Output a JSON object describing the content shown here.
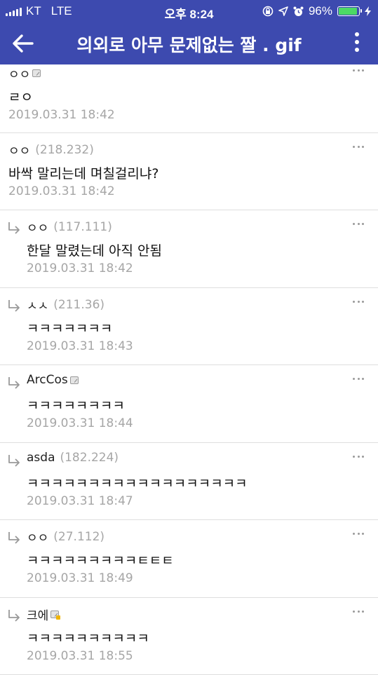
{
  "status_bar": {
    "carrier": "KT",
    "network": "LTE",
    "time": "오후 8:24",
    "battery_percent": "96%",
    "battery_level": 0.96,
    "icons": [
      "signal-icon",
      "orientation-lock-icon",
      "location-icon",
      "alarm-icon",
      "battery-icon",
      "charging-icon"
    ]
  },
  "toolbar": {
    "title": "의외로 아무 문제없는 짤 . gif",
    "back_icon": "back-arrow-icon",
    "menu_icon": "more-vertical-icon"
  },
  "colors": {
    "toolbar": "#3d4aaf",
    "meta": "#a6a6a6",
    "divider": "#dedede"
  },
  "comments": [
    {
      "author": "ㅇㅇ",
      "ip": "",
      "badge": "member",
      "reply": false,
      "body": "ㄹㅇ",
      "time": "2019.03.31 18:42"
    },
    {
      "author": "ㅇㅇ",
      "ip": "(218.232)",
      "badge": "",
      "reply": false,
      "body": "바싹 말리는데 며칠걸리냐?",
      "time": "2019.03.31 18:42"
    },
    {
      "author": "ㅇㅇ",
      "ip": "(117.111)",
      "badge": "",
      "reply": true,
      "body": "한달 말렸는데 아직 안됨",
      "time": "2019.03.31 18:42"
    },
    {
      "author": "ㅅㅅ",
      "ip": "(211.36)",
      "badge": "",
      "reply": true,
      "body": "ㅋㅋㅋㅋㅋㅋㅋ",
      "time": "2019.03.31 18:43"
    },
    {
      "author": "ArcCos",
      "ip": "",
      "badge": "member",
      "reply": true,
      "body": "ㅋㅋㅋㅋㅋㅋㅋㅋ",
      "time": "2019.03.31 18:44"
    },
    {
      "author": "asda",
      "ip": "(182.224)",
      "badge": "",
      "reply": true,
      "body": "ㅋㅋㅋㅋㅋㅋㅋㅋㅋㅋㅋㅋㅋㅋㅋㅋㅋㅋ",
      "time": "2019.03.31 18:47"
    },
    {
      "author": "ㅇㅇ",
      "ip": "(27.112)",
      "badge": "",
      "reply": true,
      "body": "ㅋㅋㅋㅋㅋㅋㅋㅋㅋㅌㅌㅌ",
      "time": "2019.03.31 18:49"
    },
    {
      "author": "크에",
      "ip": "",
      "badge": "member-gold",
      "reply": true,
      "body": "ㅋㅋㅋㅋㅋㅋㅋㅋㅋㅋ",
      "time": "2019.03.31 18:55"
    }
  ]
}
